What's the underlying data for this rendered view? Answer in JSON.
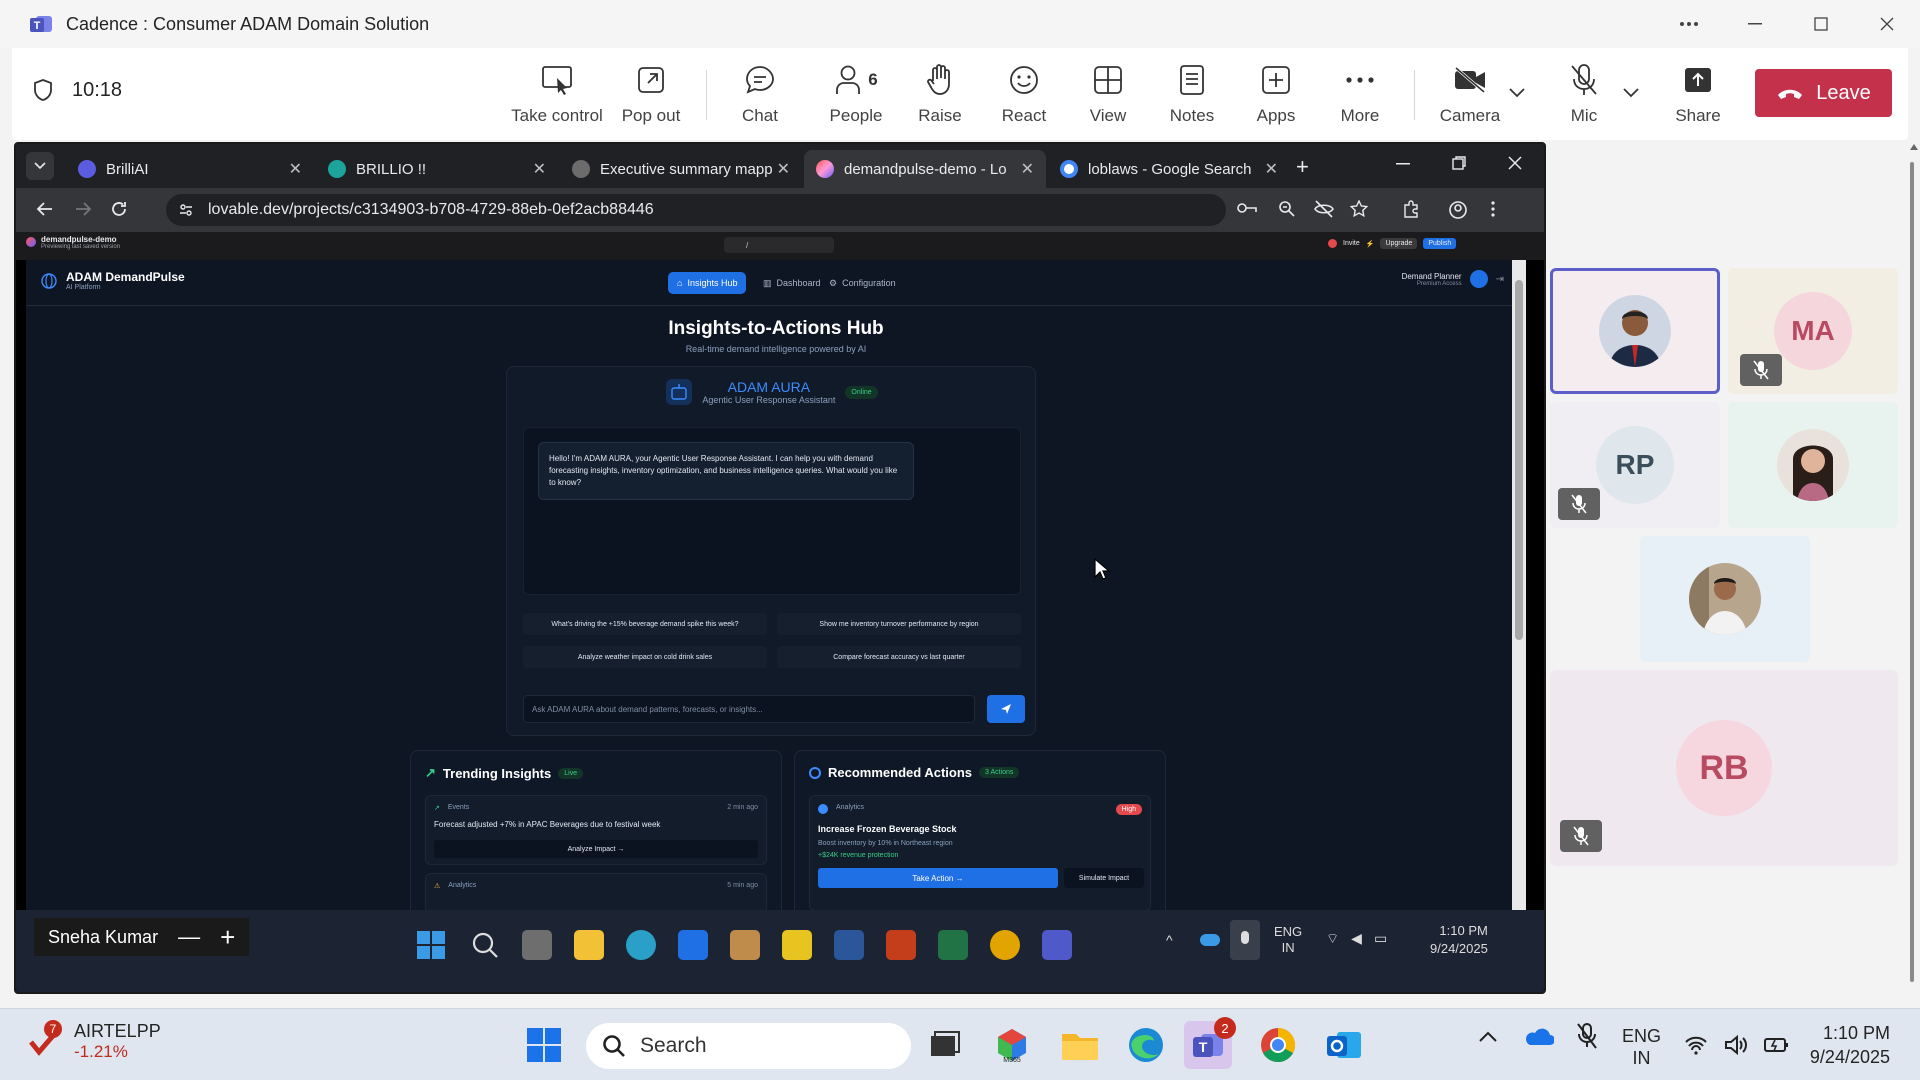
{
  "window": {
    "title": "Cadence : Consumer ADAM Domain Solution",
    "controls": [
      "more-options",
      "minimize",
      "maximize",
      "close"
    ]
  },
  "meeting_toolbar": {
    "timer": "10:18",
    "buttons": {
      "take_control": "Take control",
      "pop_out": "Pop out",
      "chat": "Chat",
      "people": "People",
      "people_count": "6",
      "raise": "Raise",
      "react": "React",
      "view": "View",
      "notes": "Notes",
      "apps": "Apps",
      "more": "More",
      "camera": "Camera",
      "mic": "Mic",
      "share": "Share",
      "leave": "Leave"
    },
    "leave_color": "#c4314b"
  },
  "browser": {
    "tabs": [
      {
        "label": "BrilliAI"
      },
      {
        "label": "BRILLIO !!"
      },
      {
        "label": "Executive summary mapp"
      },
      {
        "label": "demandpulse-demo - Lo"
      },
      {
        "label": "loblaws - Google Search"
      }
    ],
    "active_tab_index": 3,
    "url": "lovable.dev/projects/c3134903-b708-4729-88eb-0ef2acb88446"
  },
  "lovable": {
    "project": "demandpulse-demo",
    "preview_note": "Previewing last saved version",
    "path": "/",
    "invite": "Invite",
    "upgrade": "Upgrade",
    "publish": "Publish"
  },
  "app": {
    "brand_name": "ADAM DemandPulse",
    "brand_sub": "AI Platform",
    "nav": [
      "Insights Hub",
      "Dashboard",
      "Configuration"
    ],
    "user_role": "Demand Planner",
    "user_access": "Premium Access",
    "hero_title": "Insights-to-Actions Hub",
    "hero_sub": "Real-time demand intelligence powered by AI",
    "assistant_name": "ADAM AURA",
    "assistant_desc": "Agentic User Response Assistant",
    "assistant_status": "Online",
    "greeting": "Hello! I'm ADAM AURA, your Agentic User Response Assistant. I can help you with demand forecasting insights, inventory optimization, and business intelligence queries. What would you like to know?",
    "suggestions": [
      "What's driving the +15% beverage demand spike this week?",
      "Show me inventory turnover performance by region",
      "Analyze weather impact on cold drink sales",
      "Compare forecast accuracy vs last quarter"
    ],
    "input_placeholder": "Ask ADAM AURA about demand patterns, forecasts, or insights...",
    "trending": {
      "title": "Trending Insights",
      "chip": "Live",
      "items": [
        {
          "tag": "Events",
          "time": "2 min ago",
          "text": "Forecast adjusted +7% in APAC Beverages due to festival week",
          "action": "Analyze Impact"
        },
        {
          "tag": "Analytics",
          "time": "5 min ago"
        }
      ]
    },
    "actions": {
      "title": "Recommended Actions",
      "chip": "3 Actions",
      "item": {
        "tag": "Analytics",
        "priority": "High",
        "title": "Increase Frozen Beverage Stock",
        "desc": "Boost inventory by 10% in Northeast region",
        "impact": "+$24K revenue protection",
        "primary": "Take Action",
        "secondary": "Simulate Impact"
      }
    }
  },
  "remote_taskbar": {
    "presenter": "Sneha Kumar",
    "lang": "ENG",
    "region": "IN",
    "time": "1:10 PM",
    "date": "9/24/2025"
  },
  "participants": [
    {
      "type": "photo",
      "muted": false,
      "active": true
    },
    {
      "initials": "MA",
      "muted": true,
      "color": "#f5d6dc"
    },
    {
      "initials": "RP",
      "muted": true,
      "color": "#dfe7ec"
    },
    {
      "type": "photo",
      "muted": false
    },
    {
      "type": "photo",
      "muted": false
    },
    {
      "initials": "RB",
      "muted": true,
      "color": "#f7d7df"
    }
  ],
  "taskbar": {
    "stock_name": "AIRTELPP",
    "stock_change": "-1.21%",
    "stock_badge": "7",
    "search": "Search",
    "teams_badge": "2",
    "lang": "ENG",
    "region": "IN",
    "time": "1:10 PM",
    "date": "9/24/2025"
  }
}
